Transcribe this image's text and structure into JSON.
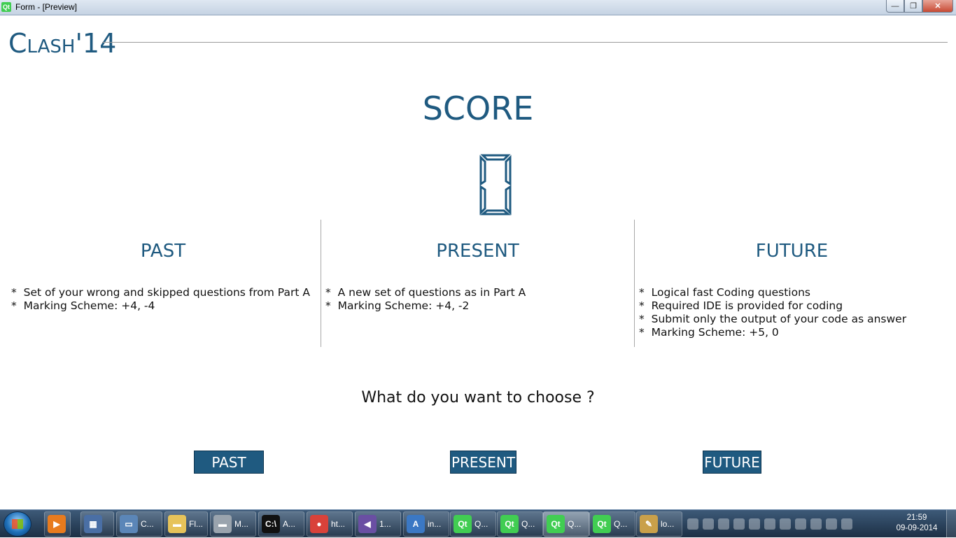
{
  "window": {
    "title": "Form - [Preview]",
    "app_icon": "qt-icon",
    "app_icon_text": "Qt",
    "minimize_glyph": "—",
    "maximize_glyph": "❐",
    "close_glyph": "✕"
  },
  "logo": {
    "big_c": "C",
    "small": "LASH",
    "suffix": "'14"
  },
  "score": {
    "title": "SCORE",
    "value": "0"
  },
  "columns": [
    {
      "title": "PAST",
      "items": [
        "Set of your wrong and skipped questions from Part A",
        "Marking Scheme: +4, -4"
      ]
    },
    {
      "title": "PRESENT",
      "items": [
        "A new set of questions as in Part A",
        "Marking Scheme: +4, -2"
      ]
    },
    {
      "title": "FUTURE",
      "items": [
        "Logical fast Coding questions",
        "Required IDE is provided for coding",
        "Submit only the output of your code as answer",
        "Marking Scheme: +5, 0"
      ]
    }
  ],
  "question": "What do you want to choose ?",
  "buttons": {
    "past": "PAST",
    "present": "PRESENT",
    "future": "FUTURE"
  },
  "colors": {
    "accent": "#1f5a80",
    "taskbar": "#2a4560"
  },
  "taskbar": {
    "items": [
      {
        "label": "",
        "icon": "media-player-icon",
        "glyph": "▶",
        "color": "#e87b1e"
      },
      {
        "label": "",
        "icon": "film-icon",
        "glyph": "▦",
        "color": "#4a6fa5"
      },
      {
        "label": "C...",
        "icon": "computer-icon",
        "glyph": "▭",
        "color": "#5b86b8"
      },
      {
        "label": "Fl...",
        "icon": "folder-icon",
        "glyph": "▬",
        "color": "#e6c35a"
      },
      {
        "label": "M...",
        "icon": "drive-icon",
        "glyph": "▬",
        "color": "#9aa4ae"
      },
      {
        "label": "A...",
        "icon": "terminal-icon",
        "glyph": "C:\\",
        "color": "#111111"
      },
      {
        "label": "ht...",
        "icon": "chrome-icon",
        "glyph": "●",
        "color": "#d9423a"
      },
      {
        "label": "1...",
        "icon": "visual-studio-icon",
        "glyph": "◀",
        "color": "#6a4fa3"
      },
      {
        "label": "in...",
        "icon": "document-icon",
        "glyph": "A",
        "color": "#3b78c4"
      },
      {
        "label": "Q...",
        "icon": "qt-creator-icon",
        "glyph": "Qt",
        "color": "#41cd52"
      },
      {
        "label": "Q...",
        "icon": "qt-creator-icon",
        "glyph": "Qt",
        "color": "#41cd52"
      },
      {
        "label": "Q...",
        "icon": "qt-creator-icon",
        "glyph": "Qt",
        "color": "#41cd52"
      },
      {
        "label": "Q...",
        "icon": "qt-creator-icon",
        "glyph": "Qt",
        "color": "#41cd52"
      },
      {
        "label": "lo...",
        "icon": "paint-icon",
        "glyph": "✎",
        "color": "#c9a04a"
      }
    ],
    "tray_icons": [
      "shield-icon",
      "bluetooth-icon",
      "battery-icon",
      "volume-icon",
      "keyboard-icon",
      "network-icon",
      "monitor-icon",
      "update-icon",
      "avast-icon",
      "tools-icon",
      "flag-icon"
    ],
    "clock_time": "21:59",
    "clock_date": "09-09-2014"
  }
}
